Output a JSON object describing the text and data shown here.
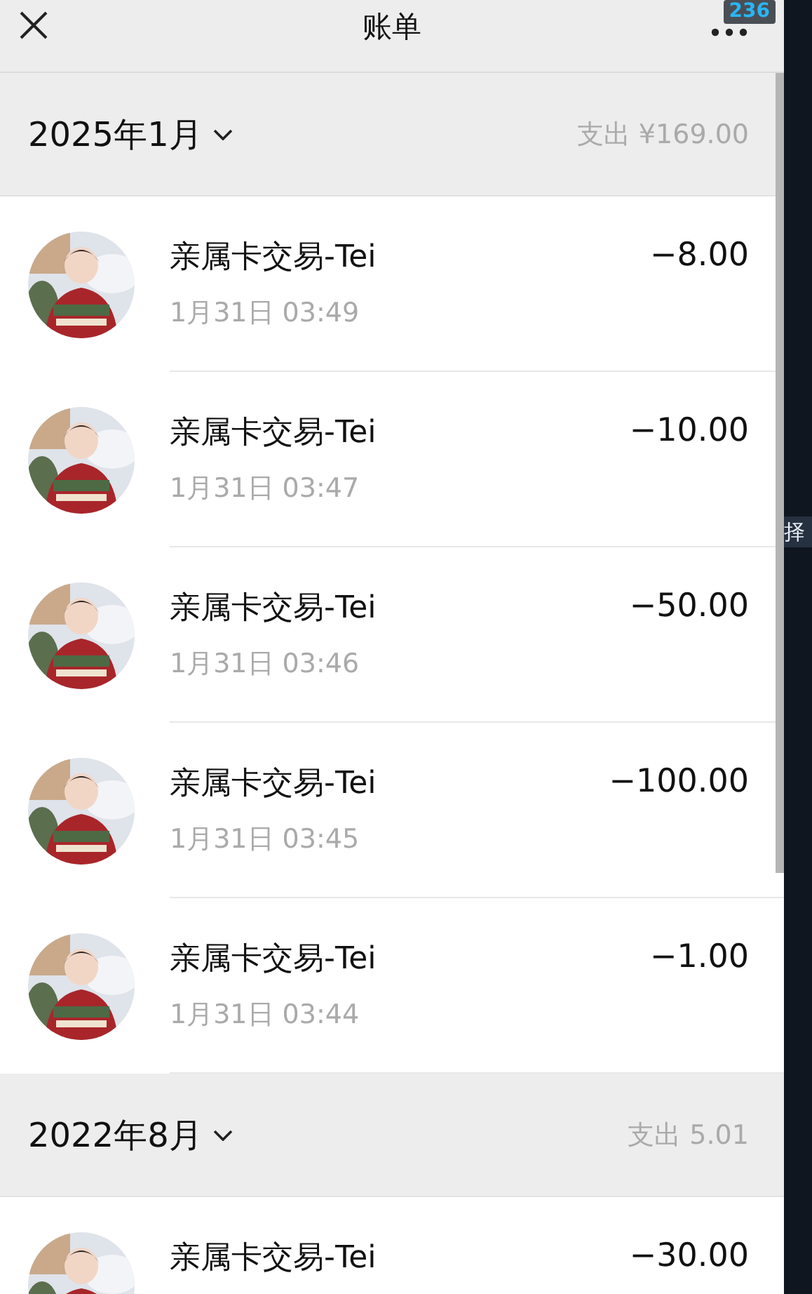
{
  "top_bar": {
    "title": "账单",
    "badge": "236"
  },
  "side_strip": {
    "label": "择"
  },
  "groups": [
    {
      "month": "2025年1月",
      "total_label": "支出",
      "total": "¥169.00",
      "items": [
        {
          "title": "亲属卡交易-Tei",
          "time": "1月31日 03:49",
          "amount": "−8.00"
        },
        {
          "title": "亲属卡交易-Tei",
          "time": "1月31日 03:47",
          "amount": "−10.00"
        },
        {
          "title": "亲属卡交易-Tei",
          "time": "1月31日 03:46",
          "amount": "−50.00"
        },
        {
          "title": "亲属卡交易-Tei",
          "time": "1月31日 03:45",
          "amount": "−100.00"
        },
        {
          "title": "亲属卡交易-Tei",
          "time": "1月31日 03:44",
          "amount": "−1.00"
        }
      ]
    },
    {
      "month": "2022年8月",
      "total_label": "支出",
      "total": "5.01",
      "items": [
        {
          "title": "亲属卡交易-Tei",
          "amount": "−30.00"
        }
      ]
    }
  ]
}
